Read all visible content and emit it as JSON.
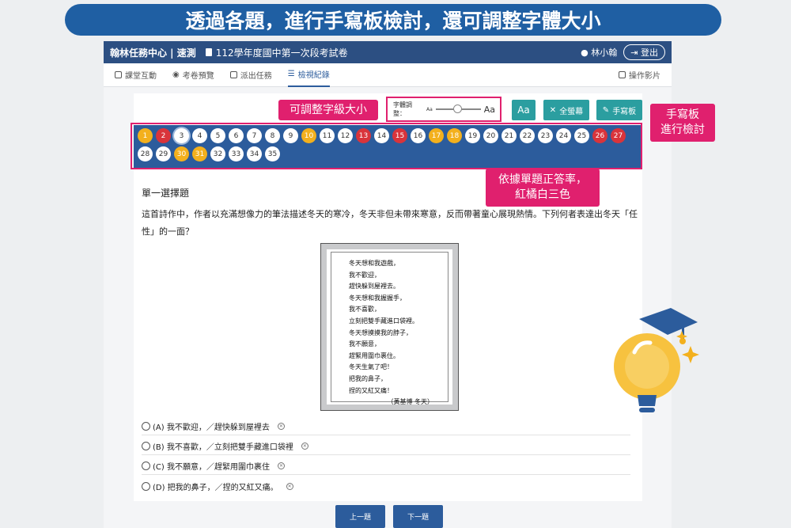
{
  "banner": "透過各題，進行手寫板檢討，還可調整字體大小",
  "topbar": {
    "brand": "翰林任務中心 | 速測",
    "doc_title": "112學年度國中第一次段考試卷",
    "user": "林小翰",
    "logout": "登出"
  },
  "tabs": [
    "課堂互動",
    "考卷預覽",
    "派出任務",
    "檢視紀錄"
  ],
  "help_label": "操作影片",
  "font_adjust": {
    "label": "字體調整：",
    "small": "Aa",
    "large": "Aa"
  },
  "buttons": {
    "aa": "Aa",
    "fullscreen": "全螢幕",
    "handwriting": "手寫板"
  },
  "question_numbers": [
    {
      "n": "1",
      "s": "orange"
    },
    {
      "n": "2",
      "s": "red"
    },
    {
      "n": "3",
      "s": "current"
    },
    {
      "n": "4",
      "s": "white"
    },
    {
      "n": "5",
      "s": "white"
    },
    {
      "n": "6",
      "s": "white"
    },
    {
      "n": "7",
      "s": "white"
    },
    {
      "n": "8",
      "s": "white"
    },
    {
      "n": "9",
      "s": "white"
    },
    {
      "n": "10",
      "s": "orange"
    },
    {
      "n": "11",
      "s": "white"
    },
    {
      "n": "12",
      "s": "white"
    },
    {
      "n": "13",
      "s": "red"
    },
    {
      "n": "14",
      "s": "white"
    },
    {
      "n": "15",
      "s": "red"
    },
    {
      "n": "16",
      "s": "white"
    },
    {
      "n": "17",
      "s": "orange"
    },
    {
      "n": "18",
      "s": "orange"
    },
    {
      "n": "19",
      "s": "white"
    },
    {
      "n": "20",
      "s": "white"
    },
    {
      "n": "21",
      "s": "white"
    },
    {
      "n": "22",
      "s": "white"
    },
    {
      "n": "23",
      "s": "white"
    },
    {
      "n": "24",
      "s": "white"
    },
    {
      "n": "25",
      "s": "white"
    },
    {
      "n": "26",
      "s": "red"
    },
    {
      "n": "27",
      "s": "red"
    },
    {
      "n": "28",
      "s": "white"
    },
    {
      "n": "29",
      "s": "white"
    },
    {
      "n": "30",
      "s": "orange"
    },
    {
      "n": "31",
      "s": "orange"
    },
    {
      "n": "32",
      "s": "white"
    },
    {
      "n": "33",
      "s": "white"
    },
    {
      "n": "34",
      "s": "white"
    },
    {
      "n": "35",
      "s": "white"
    }
  ],
  "question": {
    "type": "單一選擇題",
    "text": "這首詩作中，作者以充滿想像力的筆法描述冬天的寒冷，冬天非但未帶來寒意，反而帶著童心展現熱情。下列何者表達出冬天「任性」的一面？",
    "poem": [
      "冬天想和我遊戲，",
      "我不歡迎，",
      "趕快躲到屋裡去。",
      "冬天想和我握握手，",
      "我不喜歡，",
      "立刻把雙手藏進口袋裡。",
      "冬天想摸摸我的脖子，",
      "我不願意，",
      "趕緊用圍巾裹住。",
      "冬天生氣了吧！",
      "把我的鼻子，",
      "捏的又紅又痛！"
    ],
    "poem_author": "（黃基博 冬天）",
    "options": [
      "(A) 我不歡迎，／趕快躲到屋裡去",
      "(B) 我不喜歡，／立刻把雙手藏進口袋裡",
      "(C) 我不願意，／趕緊用圍巾裹住",
      "(D) 把我的鼻子，／捏的又紅又痛。"
    ]
  },
  "nav": {
    "prev": "上一題",
    "next": "下一題"
  },
  "callouts": {
    "font": "可調整字級大小",
    "handwriting": "手寫板\n進行檢討",
    "accuracy": "依據單題正答率，\n紅橘白三色"
  },
  "colors": {
    "banner": "#1f5fa3",
    "topbar": "#2c4f82",
    "accent_pink": "#e0206e",
    "teal": "#2b9ea0",
    "red": "#d9343b",
    "orange": "#f3b01d"
  }
}
